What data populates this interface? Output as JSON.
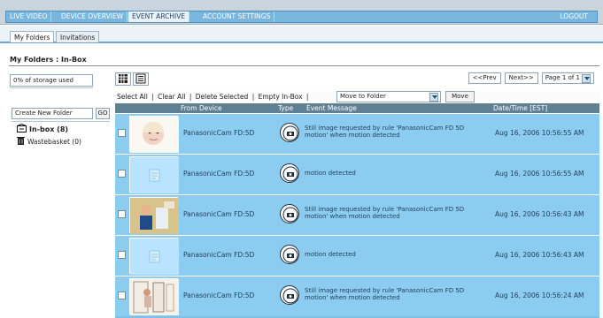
{
  "nav": {
    "tabs": [
      {
        "label": "LIVE VIDEO",
        "active": false
      },
      {
        "label": "DEVICE OVERVIEW",
        "active": false
      },
      {
        "label": "EVENT ARCHIVE",
        "active": true
      },
      {
        "label": "ACCOUNT SETTINGS",
        "active": false
      }
    ],
    "logout_label": "LOGOUT"
  },
  "subtabs": [
    {
      "label": "My Folders",
      "active": true
    },
    {
      "label": "Invitations",
      "active": false
    }
  ],
  "page": {
    "title": "My Folders : In-Box",
    "storage_used": "0% of storage used"
  },
  "views": {
    "grid_icon": "grid-view-icon",
    "list_icon": "list-view-icon"
  },
  "pager": {
    "prev_label": "<<Prev",
    "next_label": "Next>>",
    "page_label": "Page 1 of 1"
  },
  "actions": {
    "select_all": "Select All",
    "clear_all": "Clear All",
    "delete_selected": "Delete Selected",
    "empty_inbox": "Empty In-Box",
    "move_to_folder": "Move to Folder",
    "move_button": "Move"
  },
  "sidebar": {
    "create_folder_label": "Create New Folder",
    "go_label": "GO",
    "folders": [
      {
        "label": "In-box (8)"
      },
      {
        "label": "Wastebasket (0)"
      }
    ]
  },
  "table": {
    "headers": [
      "From Device",
      "Type",
      "Event Message",
      "Date/Time [EST]"
    ],
    "rows": [
      {
        "thumb": "baby-photo",
        "device": "PanasonicCam FD:5D",
        "message": "Still image requested by rule 'PanasonicCam FD 5D motion' when motion detected",
        "date": "Aug 16, 2006 10:56:55 AM"
      },
      {
        "thumb": "document-placeholder",
        "device": "PanasonicCam FD:5D",
        "message": "motion detected",
        "date": "Aug 16, 2006 10:56:55 AM"
      },
      {
        "thumb": "person-photo",
        "device": "PanasonicCam FD:5D",
        "message": "Still image requested by rule 'PanasonicCam FD 5D motion' when motion detected",
        "date": "Aug 16, 2006 10:56:43 AM"
      },
      {
        "thumb": "document-placeholder",
        "device": "PanasonicCam FD:5D",
        "message": "motion detected",
        "date": "Aug 16, 2006 10:56:43 AM"
      },
      {
        "thumb": "door-photo",
        "device": "PanasonicCam FD:5D",
        "message": "Still image requested by rule 'PanasonicCam FD 5D motion' when motion detected",
        "date": "Aug 16, 2006 10:56:24 AM"
      }
    ]
  }
}
